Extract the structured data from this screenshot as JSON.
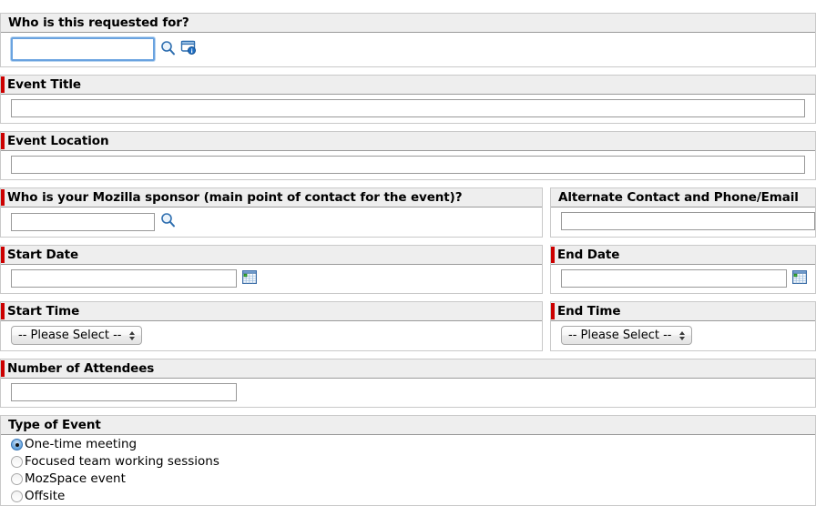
{
  "colors": {
    "required_marker": "#cc0000",
    "header_band": "#eeeeee",
    "border": "#c9c9c9",
    "focus_ring": "#6aa3e0"
  },
  "form": {
    "sections": [
      {
        "id": "requested-for",
        "label": "Who is this requested for?",
        "required": false,
        "input_value": "",
        "input_placeholder": "",
        "icons": [
          "search-icon",
          "lookup-card-icon"
        ]
      },
      {
        "id": "event-title",
        "label": "Event Title",
        "required": true,
        "input_value": "",
        "input_placeholder": ""
      },
      {
        "id": "event-location",
        "label": "Event Location",
        "required": true,
        "input_value": "",
        "input_placeholder": ""
      },
      {
        "id": "mozilla-sponsor",
        "label": "Who is your Mozilla sponsor (main point of contact for the event)?",
        "required": true,
        "input_value": "",
        "input_placeholder": "",
        "icons": [
          "search-icon"
        ]
      },
      {
        "id": "alternate-contact",
        "label": "Alternate Contact and Phone/Email",
        "required": false,
        "input_value": "",
        "input_placeholder": ""
      },
      {
        "id": "start-date",
        "label": "Start Date",
        "required": true,
        "input_value": "",
        "input_placeholder": "",
        "icons": [
          "calendar-icon"
        ]
      },
      {
        "id": "end-date",
        "label": "End Date",
        "required": true,
        "input_value": "",
        "input_placeholder": "",
        "icons": [
          "calendar-icon"
        ]
      },
      {
        "id": "start-time",
        "label": "Start Time",
        "required": true,
        "selected_option": "-- Please Select --"
      },
      {
        "id": "end-time",
        "label": "End Time",
        "required": true,
        "selected_option": "-- Please Select --"
      },
      {
        "id": "number-of-attendees",
        "label": "Number of Attendees",
        "required": true,
        "input_value": "",
        "input_placeholder": ""
      },
      {
        "id": "type-of-event",
        "label": "Type of Event",
        "required": false,
        "options": [
          {
            "label": "One-time meeting",
            "selected": true
          },
          {
            "label": "Focused team working sessions",
            "selected": false
          },
          {
            "label": "MozSpace event",
            "selected": false
          },
          {
            "label": "Offsite",
            "selected": false
          }
        ]
      }
    ]
  }
}
